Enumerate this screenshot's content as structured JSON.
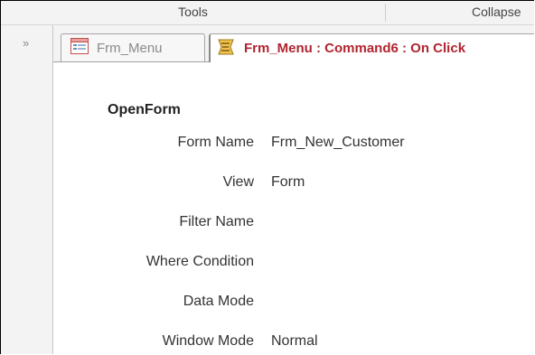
{
  "ribbon": {
    "group_tools": "Tools",
    "group_collapse": "Collapse"
  },
  "nav": {
    "expand_glyph": "»"
  },
  "tabs": [
    {
      "label": "Frm_Menu",
      "icon": "form-icon",
      "active": false
    },
    {
      "label": "Frm_Menu : Command6 : On Click",
      "icon": "macro-icon",
      "active": true
    }
  ],
  "macro": {
    "action": "OpenForm",
    "arguments": [
      {
        "label": "Form Name",
        "value": "Frm_New_Customer"
      },
      {
        "label": "View",
        "value": "Form"
      },
      {
        "label": "Filter Name",
        "value": ""
      },
      {
        "label": "Where Condition",
        "value": ""
      },
      {
        "label": "Data Mode",
        "value": ""
      },
      {
        "label": "Window Mode",
        "value": "Normal"
      }
    ]
  },
  "colors": {
    "active_tab_text": "#b0252f",
    "chrome_background": "#f3f3f3"
  }
}
